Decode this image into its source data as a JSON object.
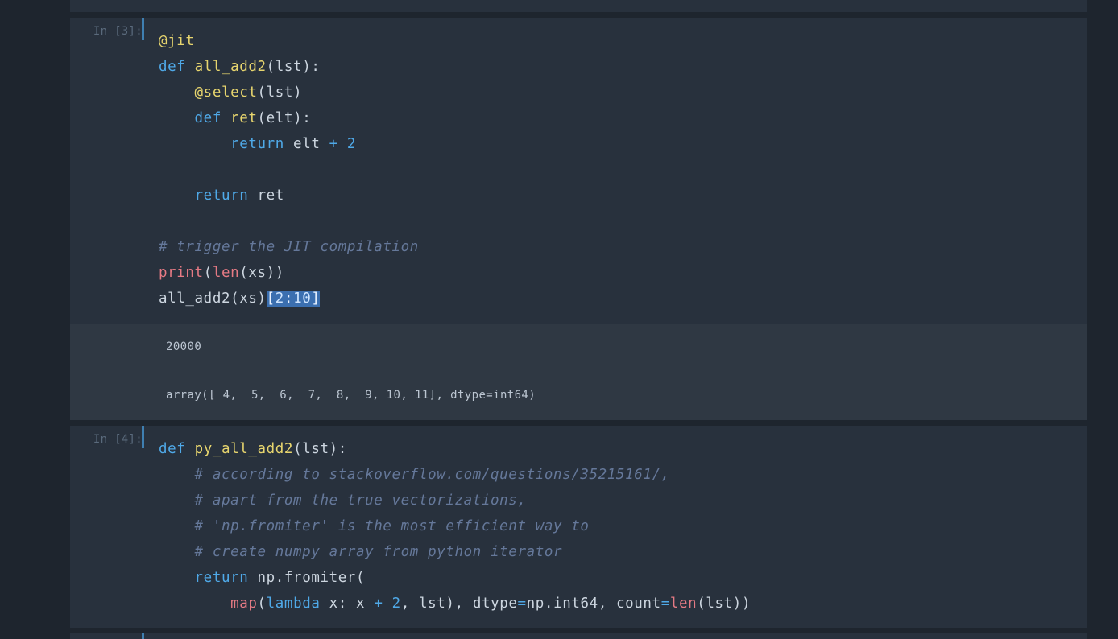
{
  "cells": [
    {
      "prompt": "In [3]:",
      "lines": {
        "l1": {
          "dec": "@jit"
        },
        "l2": {
          "kw": "def",
          "fn": "all_add2",
          "rest": "(lst):"
        },
        "l3": {
          "indent": "    ",
          "dec": "@select",
          "rest": "(lst)"
        },
        "l4": {
          "indent": "    ",
          "kw": "def",
          "fn": "ret",
          "rest": "(elt):"
        },
        "l5": {
          "indent": "        ",
          "kw": "return",
          "mid": " elt ",
          "op": "+",
          "num": "2"
        },
        "l7": {
          "indent": "    ",
          "kw": "return",
          "rest": " ret"
        },
        "l9": {
          "comment": "# trigger the JIT compilation"
        },
        "l10": {
          "bi1": "print",
          "p1": "(",
          "bi2": "len",
          "rest": "(xs))"
        },
        "l11": {
          "pre": "all_add2(xs)",
          "lb": "[",
          "n1": "2",
          "colon": ":",
          "n2": "10",
          "rb": "]"
        }
      },
      "outputs": [
        "20000",
        "array([ 4,  5,  6,  7,  8,  9, 10, 11], dtype=int64)"
      ]
    },
    {
      "prompt": "In [4]:",
      "lines": {
        "l1": {
          "kw": "def",
          "fn": "py_all_add2",
          "rest": "(lst):"
        },
        "l2": {
          "indent": "    ",
          "comment": "# according to stackoverflow.com/questions/35215161/,"
        },
        "l3": {
          "indent": "    ",
          "comment": "# apart from the true vectorizations,"
        },
        "l4": {
          "indent": "    ",
          "comment": "# 'np.fromiter' is the most efficient way to"
        },
        "l5": {
          "indent": "    ",
          "comment": "# create numpy array from python iterator"
        },
        "l6": {
          "indent": "    ",
          "kw": "return",
          "rest": " np.fromiter("
        },
        "l7": {
          "indent": "        ",
          "bi1": "map",
          "p1": "(",
          "kw": "lambda",
          "mid1": " x: x ",
          "op1": "+",
          "sp": " ",
          "num": "2",
          "mid2": ", lst), dtype",
          "op2": "=",
          "mid3": "np.int64, count",
          "op3": "=",
          "bi2": "len",
          "end": "(lst))"
        }
      }
    }
  ],
  "colors": {
    "background": "#1e252e",
    "cell": "#28313d",
    "output": "#2f3843",
    "keyword": "#4fa9e8",
    "function": "#e7d56e",
    "builtin": "#e57a84",
    "comment": "#65789a",
    "selection": "#3b6fb0"
  }
}
